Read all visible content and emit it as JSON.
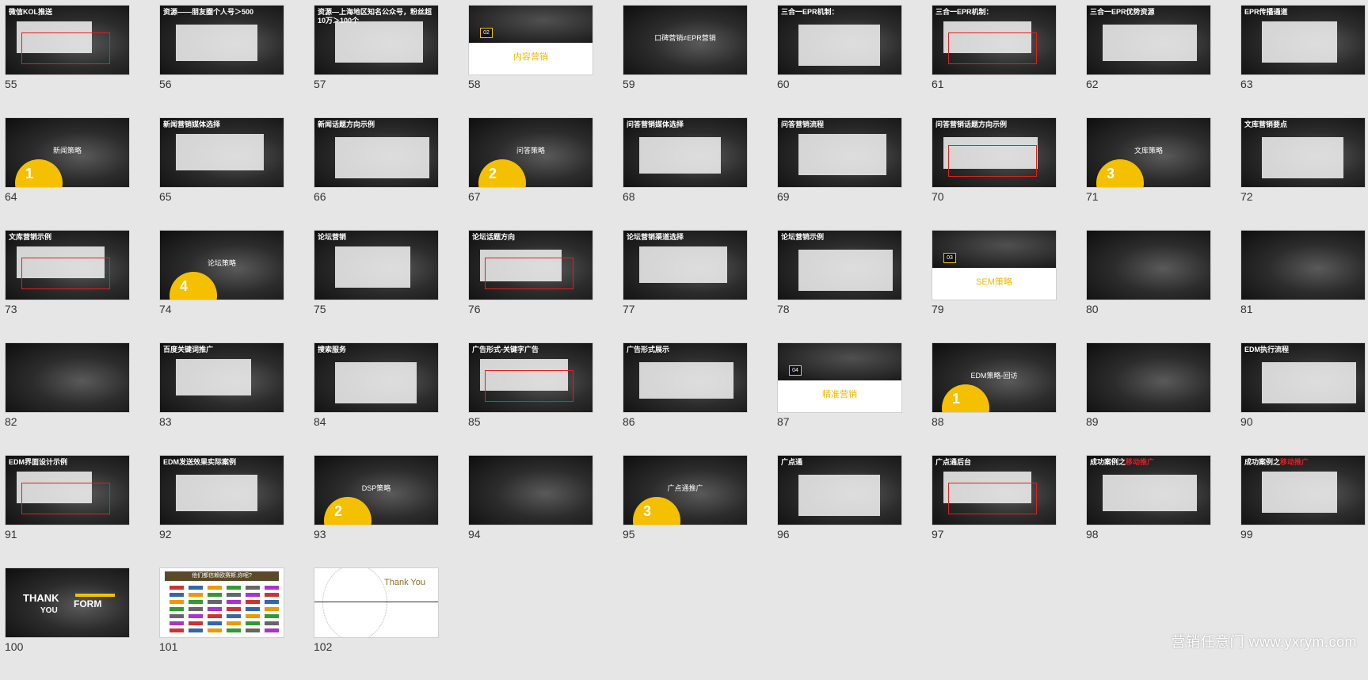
{
  "slides": [
    {
      "n": "55",
      "title": "微信KOL推送"
    },
    {
      "n": "56",
      "title": "资源——朋友圈个人号＞500"
    },
    {
      "n": "57",
      "title": "资源—上海地区知名公众号，粉丝超10万＞100个"
    },
    {
      "n": "58",
      "section": "02",
      "label": "内容营销"
    },
    {
      "n": "59",
      "title": "",
      "center": "口碑营销≠EPR营销"
    },
    {
      "n": "60",
      "title": "三合一EPR机制："
    },
    {
      "n": "61",
      "title": "三合一EPR机制："
    },
    {
      "n": "62",
      "title": "三合一EPR优势资源"
    },
    {
      "n": "63",
      "title": "EPR传播通道"
    },
    {
      "n": "64",
      "center": "新闻策略",
      "circle": "1"
    },
    {
      "n": "65",
      "title": "新闻营销媒体选择"
    },
    {
      "n": "66",
      "title": "新闻话题方向示例"
    },
    {
      "n": "67",
      "center": "问答策略",
      "circle": "2"
    },
    {
      "n": "68",
      "title": "问答营销媒体选择"
    },
    {
      "n": "69",
      "title": "问答营销流程"
    },
    {
      "n": "70",
      "title": "问答营销话题方向示例"
    },
    {
      "n": "71",
      "center": "文库策略",
      "circle": "3"
    },
    {
      "n": "72",
      "title": "文库营销要点"
    },
    {
      "n": "73",
      "title": "文库营销示例"
    },
    {
      "n": "74",
      "center": "论坛策略",
      "circle": "4"
    },
    {
      "n": "75",
      "title": "论坛营销"
    },
    {
      "n": "76",
      "title": "论坛话题方向"
    },
    {
      "n": "77",
      "title": "论坛营销渠道选择"
    },
    {
      "n": "78",
      "title": "论坛营销示例"
    },
    {
      "n": "79",
      "section": "03",
      "label": "SEM策略"
    },
    {
      "n": "80",
      "title": ""
    },
    {
      "n": "81",
      "title": ""
    },
    {
      "n": "82",
      "title": ""
    },
    {
      "n": "83",
      "title": "百度关键词推广"
    },
    {
      "n": "84",
      "title": "搜索服务"
    },
    {
      "n": "85",
      "title": "广告形式-关键字广告"
    },
    {
      "n": "86",
      "title": "广告形式展示"
    },
    {
      "n": "87",
      "section": "04",
      "label": "精准营销"
    },
    {
      "n": "88",
      "center": "EDM策略-回访",
      "circle": "1"
    },
    {
      "n": "89",
      "title": ""
    },
    {
      "n": "90",
      "title": "EDM执行流程"
    },
    {
      "n": "91",
      "title": "EDM界面设计示例"
    },
    {
      "n": "92",
      "title": "EDM发送效果实际案例"
    },
    {
      "n": "93",
      "center": "DSP策略",
      "circle": "2"
    },
    {
      "n": "94",
      "title": ""
    },
    {
      "n": "95",
      "center": "广点通推广",
      "circle": "3"
    },
    {
      "n": "96",
      "title": "广点通"
    },
    {
      "n": "97",
      "title": "广点通后台"
    },
    {
      "n": "98",
      "title": "成功案例之",
      "title_red": "移动推广"
    },
    {
      "n": "99",
      "title": "成功案例之",
      "title_red": "移动推广"
    },
    {
      "n": "100",
      "thank": [
        "THANK",
        "YOU",
        "FORM"
      ]
    },
    {
      "n": "101",
      "banner": "他们都信赖欧赛斯,你呢?"
    },
    {
      "n": "102",
      "thanks_label": "Thank You"
    }
  ],
  "watermark": "营销任意门 www.yxrym.com",
  "colors": {
    "accent": "#f5c000",
    "red": "#d22222"
  }
}
